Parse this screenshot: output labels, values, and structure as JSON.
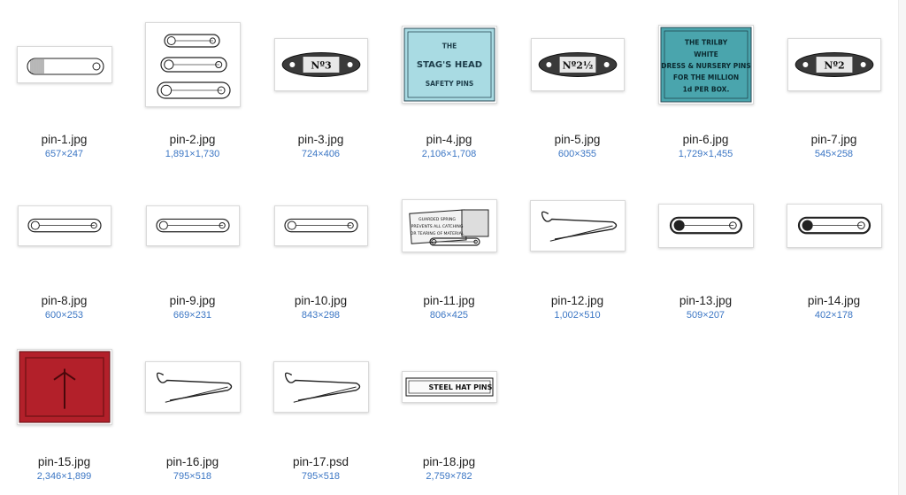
{
  "colors": {
    "filename_text": "#1f1f1f",
    "dimension_text": "#3b76c4",
    "pin_box_blue": "#a9dbe3",
    "pin_box_teal": "#4aa5ad",
    "pin_box_red": "#b3202a"
  },
  "files": [
    {
      "name": "pin-1.jpg",
      "dims": "657×247",
      "preview": "coiled-pin"
    },
    {
      "name": "pin-2.jpg",
      "dims": "1,891×1,730",
      "preview": "three-pins"
    },
    {
      "name": "pin-3.jpg",
      "dims": "724×406",
      "preview": "plate",
      "plate_text": "Nº3"
    },
    {
      "name": "pin-4.jpg",
      "dims": "2,106×1,708",
      "preview": "label-blue",
      "label_lines": [
        "THE",
        "STAG'S HEAD",
        "SAFETY PINS"
      ]
    },
    {
      "name": "pin-5.jpg",
      "dims": "600×355",
      "preview": "plate",
      "plate_text": "Nº2½"
    },
    {
      "name": "pin-6.jpg",
      "dims": "1,729×1,455",
      "preview": "label-teal",
      "label_lines": [
        "THE TRILBY",
        "WHITE",
        "DRESS & NURSERY PINS",
        "FOR THE MILLION",
        "1d PER BOX."
      ]
    },
    {
      "name": "pin-7.jpg",
      "dims": "545×258",
      "preview": "plate",
      "plate_text": "Nº2"
    },
    {
      "name": "pin-8.jpg",
      "dims": "600×253",
      "preview": "pin"
    },
    {
      "name": "pin-9.jpg",
      "dims": "669×231",
      "preview": "pin"
    },
    {
      "name": "pin-10.jpg",
      "dims": "843×298",
      "preview": "pin"
    },
    {
      "name": "pin-11.jpg",
      "dims": "806×425",
      "preview": "card",
      "card_lines": [
        "GUARDED SPRING",
        "PREVENTS ALL CATCHING",
        "OR TEARING OF MATERIAL"
      ]
    },
    {
      "name": "pin-12.jpg",
      "dims": "1,002×510",
      "preview": "open-pin"
    },
    {
      "name": "pin-13.jpg",
      "dims": "509×207",
      "preview": "dark-pin"
    },
    {
      "name": "pin-14.jpg",
      "dims": "402×178",
      "preview": "dark-pin"
    },
    {
      "name": "pin-15.jpg",
      "dims": "2,346×1,899",
      "preview": "red-box"
    },
    {
      "name": "pin-16.jpg",
      "dims": "795×518",
      "preview": "open-pin"
    },
    {
      "name": "pin-17.psd",
      "dims": "795×518",
      "preview": "open-pin"
    },
    {
      "name": "pin-18.jpg",
      "dims": "2,759×782",
      "preview": "banner",
      "banner_text": "STEEL HAT PINS"
    }
  ]
}
